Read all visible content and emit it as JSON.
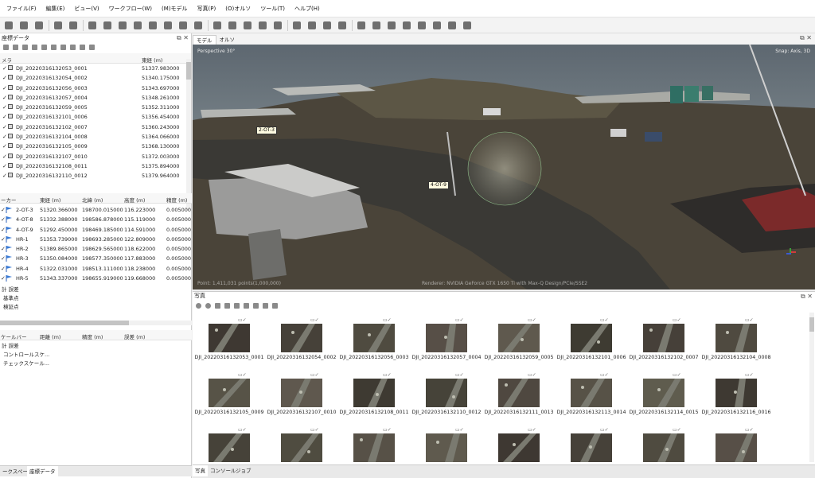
{
  "menu": [
    "ファイル(F)",
    "編集(E)",
    "ビュー(V)",
    "ワークフロー(W)",
    "(M)モデル",
    "写真(P)",
    "(O)オルソ",
    "ツール(T)",
    "ヘルプ(H)"
  ],
  "toolbar_icons": [
    "open-folder-icon",
    "folder-icon",
    "save-icon",
    "undo-icon",
    "redo-icon",
    "pointer-icon",
    "rect-select-icon",
    "paint-icon",
    "shape-icon",
    "ruler-icon",
    "draw-icon",
    "delete-icon",
    "crop-icon",
    "zoom-in-icon",
    "zoom-out-icon",
    "move-icon",
    "rotate-icon",
    "grid-icon",
    "render-icon",
    "model-icon",
    "texture-icon",
    "tiled-icon",
    "globe-icon",
    "camera-icon",
    "markers-icon",
    "list-icon",
    "orthophoto-icon",
    "flag-icon",
    "overview-icon",
    "more-icon"
  ],
  "left_panel": {
    "title": "座標データ",
    "camera_table": {
      "headers": [
        "メラ",
        "東経 (m)"
      ],
      "rows": [
        {
          "name": "DJI_20220316132053_0001",
          "east": "51337.983000"
        },
        {
          "name": "DJI_20220316132054_0002",
          "east": "51340.175000"
        },
        {
          "name": "DJI_20220316132056_0003",
          "east": "51343.697000"
        },
        {
          "name": "DJI_20220316132057_0004",
          "east": "51348.261000"
        },
        {
          "name": "DJI_20220316132059_0005",
          "east": "51352.311000"
        },
        {
          "name": "DJI_20220316132101_0006",
          "east": "51356.454000"
        },
        {
          "name": "DJI_20220316132102_0007",
          "east": "51360.243000"
        },
        {
          "name": "DJI_20220316132104_0008",
          "east": "51364.066000"
        },
        {
          "name": "DJI_20220316132105_0009",
          "east": "51368.130000"
        },
        {
          "name": "DJI_20220316132107_0010",
          "east": "51372.003000"
        },
        {
          "name": "DJI_20220316132108_0011",
          "east": "51375.894000"
        },
        {
          "name": "DJI_20220316132110_0012",
          "east": "51379.964000"
        }
      ]
    },
    "marker_table": {
      "headers": [
        "ーカー",
        "東経 (m)",
        "北緯 (m)",
        "高度 (m)",
        "精度 (m)"
      ],
      "rows": [
        {
          "name": "2-OT-3",
          "east": "51320.366000",
          "north": "198700.015000",
          "alt": "116.223000",
          "acc": "0.005000"
        },
        {
          "name": "4-OT-8",
          "east": "51332.388000",
          "north": "198586.878000",
          "alt": "115.119000",
          "acc": "0.005000"
        },
        {
          "name": "4-OT-9",
          "east": "51292.450000",
          "north": "198469.185000",
          "alt": "114.591000",
          "acc": "0.005000"
        },
        {
          "name": "HR-1",
          "east": "51353.739000",
          "north": "198693.285000",
          "alt": "122.809000",
          "acc": "0.005000"
        },
        {
          "name": "HR-2",
          "east": "51389.865000",
          "north": "198629.565000",
          "alt": "118.622000",
          "acc": "0.005000"
        },
        {
          "name": "HR-3",
          "east": "51350.084000",
          "north": "198577.350000",
          "alt": "117.883000",
          "acc": "0.005000"
        },
        {
          "name": "HR-4",
          "east": "51322.031000",
          "north": "198513.111000",
          "alt": "118.238000",
          "acc": "0.005000"
        },
        {
          "name": "HR-5",
          "east": "51343.337000",
          "north": "198655.919000",
          "alt": "119.668000",
          "acc": "0.005000"
        }
      ],
      "footer": [
        "計 誤差",
        "基準点",
        "検証点"
      ]
    },
    "scalebar_table": {
      "headers": [
        "ケールバー",
        "距離 (m)",
        "精度 (m)",
        "誤差 (m)"
      ],
      "footer": [
        "計 誤差",
        "コントロールスケ...",
        "チェックスケール..."
      ]
    },
    "bottom_tabs": [
      "ークスペース",
      "座標データ"
    ]
  },
  "view_tabs": [
    "モデル",
    "オルソ"
  ],
  "viewport": {
    "perspective": "Perspective 30°",
    "snap": "Snap: Axis, 3D",
    "gcp_labels": [
      "2-OT-3",
      "4-OT-9"
    ],
    "bottom_left": "Point: 1,411,031 points(1,000,000)",
    "bottom_center": "Renderer: NVIDIA GeForce GTX 1650 Ti with Max-Q Design/PCIe/SSE2"
  },
  "photos_panel": {
    "title": "写真",
    "items": [
      "DJI_20220316132053_0001",
      "DJI_20220316132054_0002",
      "DJI_20220316132056_0003",
      "DJI_20220316132057_0004",
      "DJI_20220316132059_0005",
      "DJI_20220316132101_0006",
      "DJI_20220316132102_0007",
      "DJI_20220316132104_0008",
      "DJI_20220316132105_0009",
      "DJI_20220316132107_0010",
      "DJI_20220316132108_0011",
      "DJI_20220316132110_0012",
      "DJI_20220316132111_0013",
      "DJI_20220316132113_0014",
      "DJI_20220316132114_0015",
      "DJI_20220316132116_0016",
      "",
      "",
      "",
      "",
      "",
      "",
      "",
      ""
    ],
    "bottom_tabs": [
      "写真",
      "コンソール",
      "ジョブ"
    ]
  }
}
